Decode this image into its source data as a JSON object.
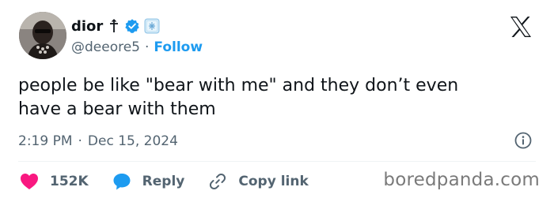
{
  "user": {
    "display_name": "dior",
    "handle": "@deeore5",
    "separator": "·",
    "follow_label": "Follow"
  },
  "tweet": {
    "text": "people be like \"bear with me\" and they don’t even\nhave a bear with them",
    "time": "2:19 PM",
    "separator": "·",
    "date": "Dec 15, 2024"
  },
  "actions": {
    "likes_count": "152K",
    "reply_label": "Reply",
    "copy_link_label": "Copy link"
  },
  "watermark": "boredpanda.com",
  "colors": {
    "text": "#0f1419",
    "muted": "#536471",
    "brand_blue": "#1d9bf0",
    "like_red": "#f91880",
    "reply_blue": "#1d9bf0"
  },
  "icons": {
    "verified": "verified-badge-icon",
    "cross": "cross-icon",
    "emoji": "emoji-badge-icon",
    "x_logo": "x-logo-icon",
    "info": "info-icon",
    "like": "heart-icon",
    "reply": "speech-bubble-icon",
    "copy": "link-icon"
  }
}
